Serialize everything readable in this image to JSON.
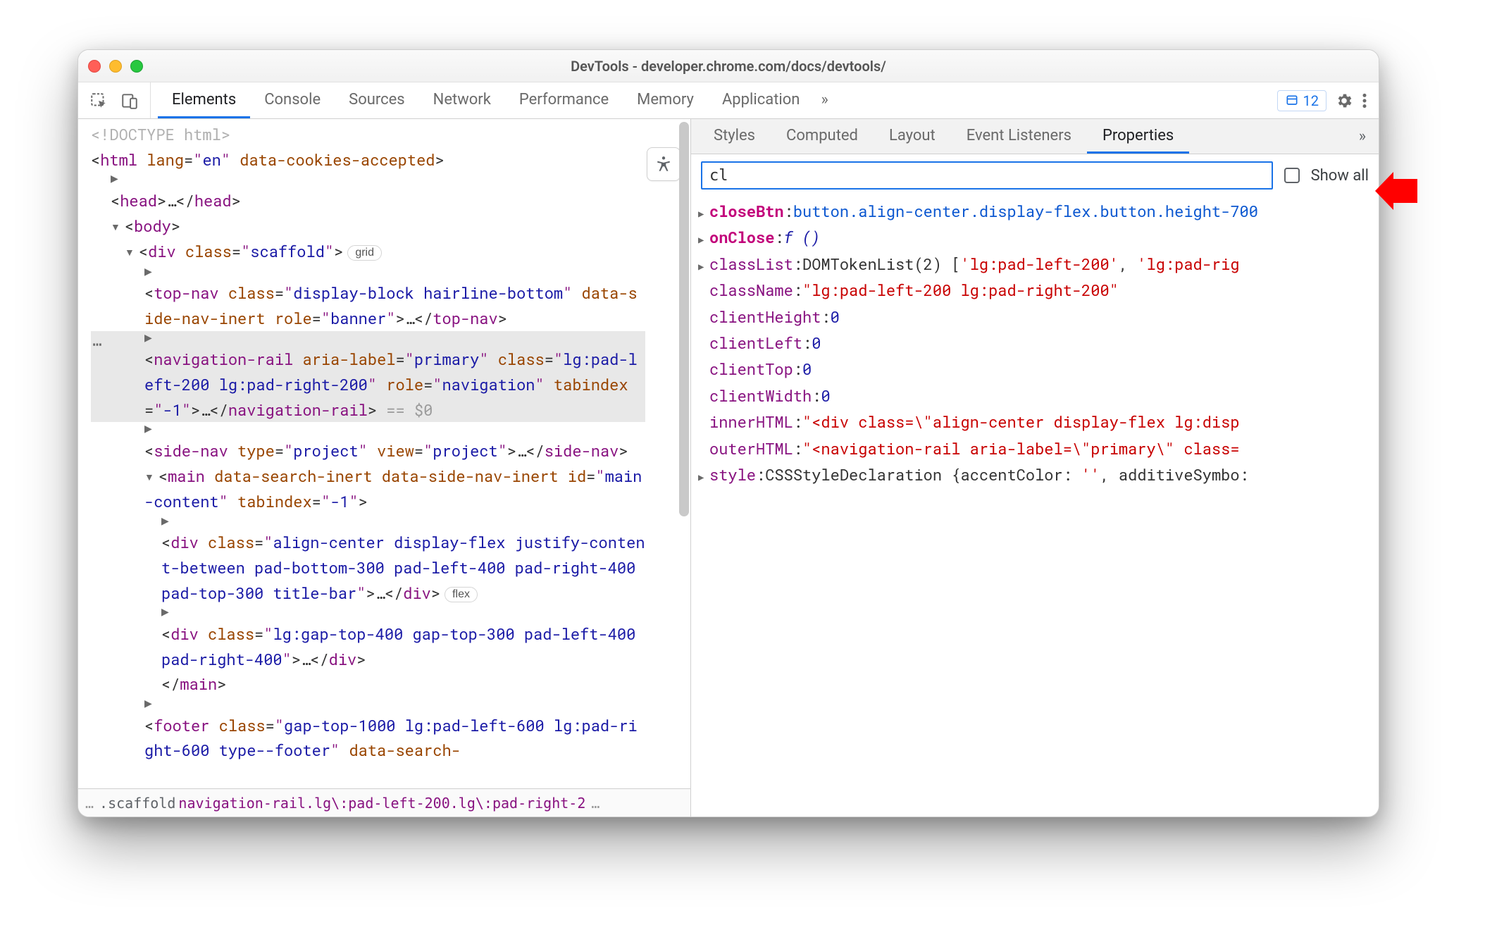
{
  "window": {
    "title": "DevTools - developer.chrome.com/docs/devtools/"
  },
  "toolbar": {
    "tabs": [
      "Elements",
      "Console",
      "Sources",
      "Network",
      "Performance",
      "Memory",
      "Application"
    ],
    "active_tab": "Elements",
    "more_tabs_glyph": "»",
    "issues_count": "12"
  },
  "elements_panel": {
    "a11y_tooltip": "Accessibility",
    "breadcrumbs": {
      "left_ellipsis": "…",
      "item1": ".scaffold",
      "item2": "navigation-rail.lg\\:pad-left-200.lg\\:pad-right-2",
      "right_ellipsis": "…"
    },
    "badges": {
      "grid": "grid",
      "flex": "flex"
    },
    "selected_suffix": "== $0",
    "dom": {
      "doctype": "<!DOCTYPE html>",
      "html_open": {
        "tag": "html",
        "attrs": [
          [
            "lang",
            "en"
          ]
        ],
        "flags": [
          "data-cookies-accepted"
        ]
      },
      "head": {
        "open": "<head>",
        "ell": "…",
        "close": "</head>"
      },
      "body_open": "<body>",
      "scaffold": {
        "tag": "div",
        "attrs": [
          [
            "class",
            "scaffold"
          ]
        ]
      },
      "topnav": {
        "tag": "top-nav",
        "attrs": [
          [
            "class",
            "display-block hairline-bottom"
          ]
        ],
        "flags": [
          "data-side-nav-inert"
        ],
        "attrs2": [
          [
            "role",
            "banner"
          ]
        ],
        "close": "</top-nav>"
      },
      "navrail_selected": {
        "tag": "navigation-rail",
        "attrs": [
          [
            "aria-label",
            "primary"
          ],
          [
            "class",
            "lg:pad-left-200 lg:pad-right-200"
          ],
          [
            "role",
            "navigation"
          ],
          [
            "tabindex",
            "-1"
          ]
        ],
        "close": "</navigation-rail>"
      },
      "sidenav": {
        "tag": "side-nav",
        "attrs": [
          [
            "type",
            "project"
          ],
          [
            "view",
            "project"
          ]
        ],
        "close": "</side-nav>"
      },
      "main": {
        "tag": "main",
        "flags": [
          "data-search-inert",
          "data-side-nav-inert"
        ],
        "attrs": [
          [
            "id",
            "main-content"
          ],
          [
            "tabindex",
            "-1"
          ]
        ]
      },
      "main_div1": {
        "tag": "div",
        "attrs": [
          [
            "class",
            "align-center display-flex justify-content-between pad-bottom-300 pad-left-400 pad-right-400 pad-top-300 title-bar"
          ]
        ],
        "close": "</div>"
      },
      "main_div2": {
        "tag": "div",
        "attrs": [
          [
            "class",
            "lg:gap-top-400 gap-top-300 pad-left-400 pad-right-400"
          ]
        ],
        "close": "</div>"
      },
      "main_close": "</main>",
      "footer": {
        "tag": "footer",
        "attrs": [
          [
            "class",
            "gap-top-1000 lg:pad-left-600 lg:pad-right-600 type--footer"
          ]
        ],
        "flags": [
          "data-search-"
        ]
      }
    }
  },
  "styles_pane": {
    "subtabs": [
      "Styles",
      "Computed",
      "Layout",
      "Event Listeners",
      "Properties"
    ],
    "active_subtab": "Properties",
    "more_glyph": "»",
    "filter_value": "cl",
    "show_all_label": "Show all",
    "show_all_checked": false,
    "properties": [
      {
        "expandable": true,
        "bold": true,
        "key": "closeBtn",
        "kind": "link",
        "value": "button.align-center.display-flex.button.height-700"
      },
      {
        "expandable": true,
        "bold": true,
        "key": "onClose",
        "kind": "func",
        "value": "f ()"
      },
      {
        "expandable": true,
        "bold": false,
        "key": "classList",
        "kind": "mixed",
        "value_prefix": "DOMTokenList(2) [",
        "strings": [
          "'lg:pad-left-200'",
          "'lg:pad-rig"
        ],
        "sep": ", "
      },
      {
        "expandable": false,
        "bold": false,
        "key": "className",
        "kind": "string",
        "value": "\"lg:pad-left-200 lg:pad-right-200\""
      },
      {
        "expandable": false,
        "bold": false,
        "key": "clientHeight",
        "kind": "number",
        "value": "0"
      },
      {
        "expandable": false,
        "bold": false,
        "key": "clientLeft",
        "kind": "number",
        "value": "0"
      },
      {
        "expandable": false,
        "bold": false,
        "key": "clientTop",
        "kind": "number",
        "value": "0"
      },
      {
        "expandable": false,
        "bold": false,
        "key": "clientWidth",
        "kind": "number",
        "value": "0"
      },
      {
        "expandable": false,
        "bold": false,
        "key": "innerHTML",
        "kind": "string",
        "value": "\"<div class=\\\"align-center display-flex lg:disp"
      },
      {
        "expandable": false,
        "bold": false,
        "key": "outerHTML",
        "kind": "string",
        "value": "\"<navigation-rail aria-label=\\\"primary\\\" class="
      },
      {
        "expandable": true,
        "bold": false,
        "key": "style",
        "kind": "obj",
        "value_prefix": "CSSStyleDeclaration {",
        "pairs": [
          [
            "accentColor",
            "''"
          ],
          [
            "additiveSymbo",
            ""
          ]
        ]
      }
    ]
  }
}
